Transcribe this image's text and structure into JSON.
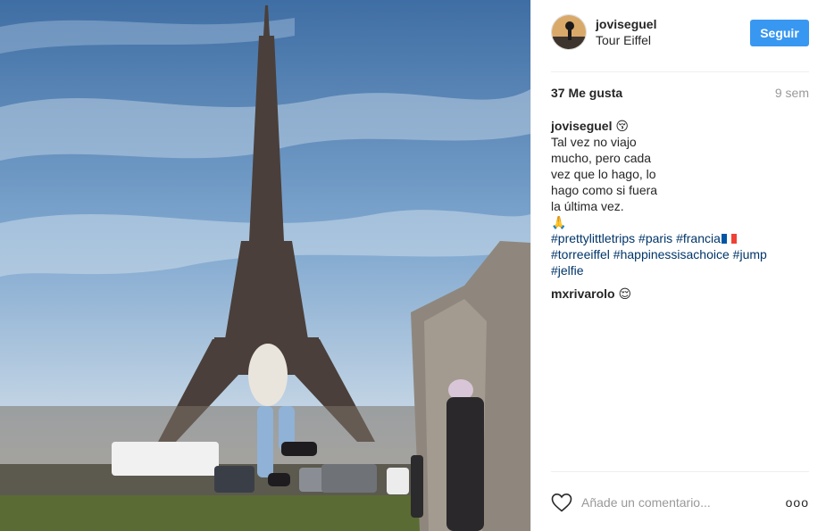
{
  "post": {
    "username": "joviseguel",
    "location": "Tour Eiffel",
    "follow_label": "Seguir",
    "likes": "37 Me gusta",
    "time": "9 sem"
  },
  "caption": {
    "username": "joviseguel",
    "emoji": "😚",
    "lines": [
      "Tal vez no viajo",
      "mucho, pero cada",
      "vez que lo hago, lo",
      "hago como si fuera",
      "la última vez."
    ],
    "pray_emoji": "🙏",
    "hashtags": {
      "h1": "#prettylittletrips",
      "h2": "#paris",
      "h3": "#francia",
      "h4": "#torreeiffel",
      "h5": "#happinessisachoice",
      "h6": "#jump",
      "h7": "#jelfie"
    },
    "flag_colors": [
      "#0055a4",
      "#ffffff",
      "#ef4135"
    ]
  },
  "comments": [
    {
      "username": "mxrivarolo",
      "emoji": "😌"
    }
  ],
  "comment_box": {
    "placeholder": "Añade un comentario...",
    "more": "ooo"
  },
  "colors": {
    "accent": "#3897f0",
    "hashtag": "#003569",
    "muted": "#999999"
  },
  "icons": {
    "like": "heart-outline-icon",
    "more": "more-options-icon"
  }
}
